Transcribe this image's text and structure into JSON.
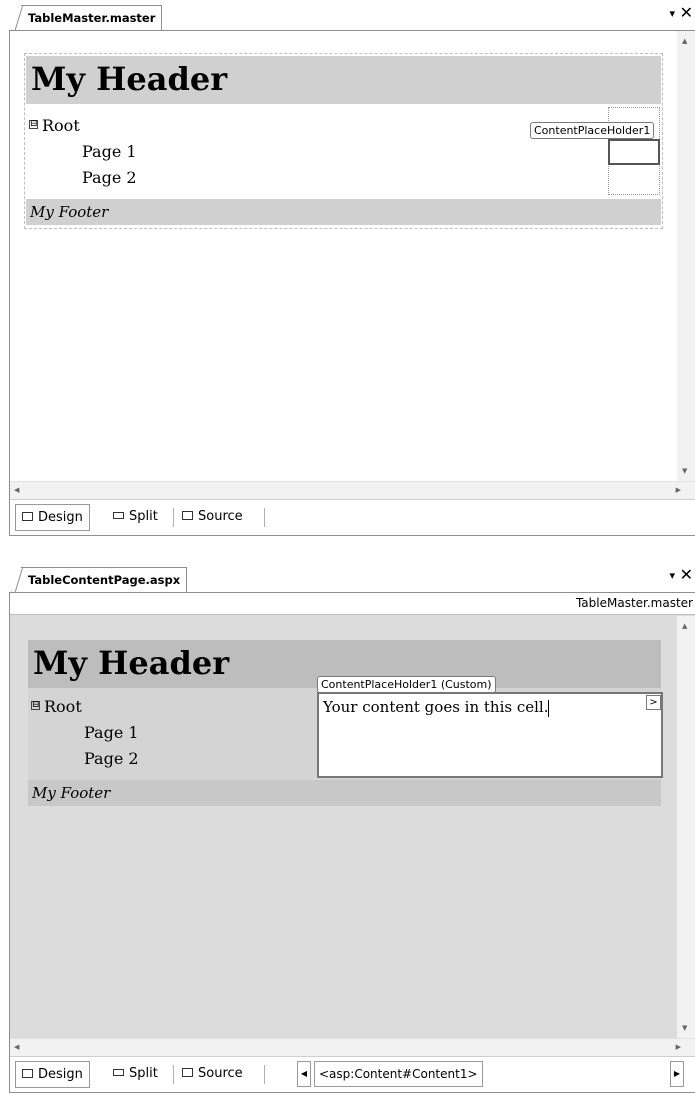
{
  "window1": {
    "tab_title": "TableMaster.master",
    "pin_glyph": "▾",
    "close_glyph": "✕",
    "header_text": "My Header",
    "tree": {
      "expander": "⊟",
      "root": "Root",
      "children": [
        "Page 1",
        "Page 2"
      ]
    },
    "footer_text": "My Footer",
    "placeholder_label": "ContentPlaceHolder1",
    "view_tabs": {
      "design": "Design",
      "split": "Split",
      "source": "Source"
    }
  },
  "window2": {
    "tab_title": "TableContentPage.aspx",
    "pin_glyph": "▾",
    "close_glyph": "✕",
    "master_label": "TableMaster.master",
    "header_text": "My Header",
    "tree": {
      "expander": "⊟",
      "root": "Root",
      "children": [
        "Page 1",
        "Page 2"
      ]
    },
    "footer_text": "My Footer",
    "placeholder_label": "ContentPlaceHolder1 (Custom)",
    "content_text": "Your content goes in this cell.",
    "smart_tag_glyph": ">",
    "view_tabs": {
      "design": "Design",
      "split": "Split",
      "source": "Source"
    },
    "tag_navigator": "<asp:Content#Content1>"
  },
  "colors": {
    "header_band": "#d0d0d0",
    "content_bg": "#dcdcdc",
    "border": "#8e8e8e"
  }
}
